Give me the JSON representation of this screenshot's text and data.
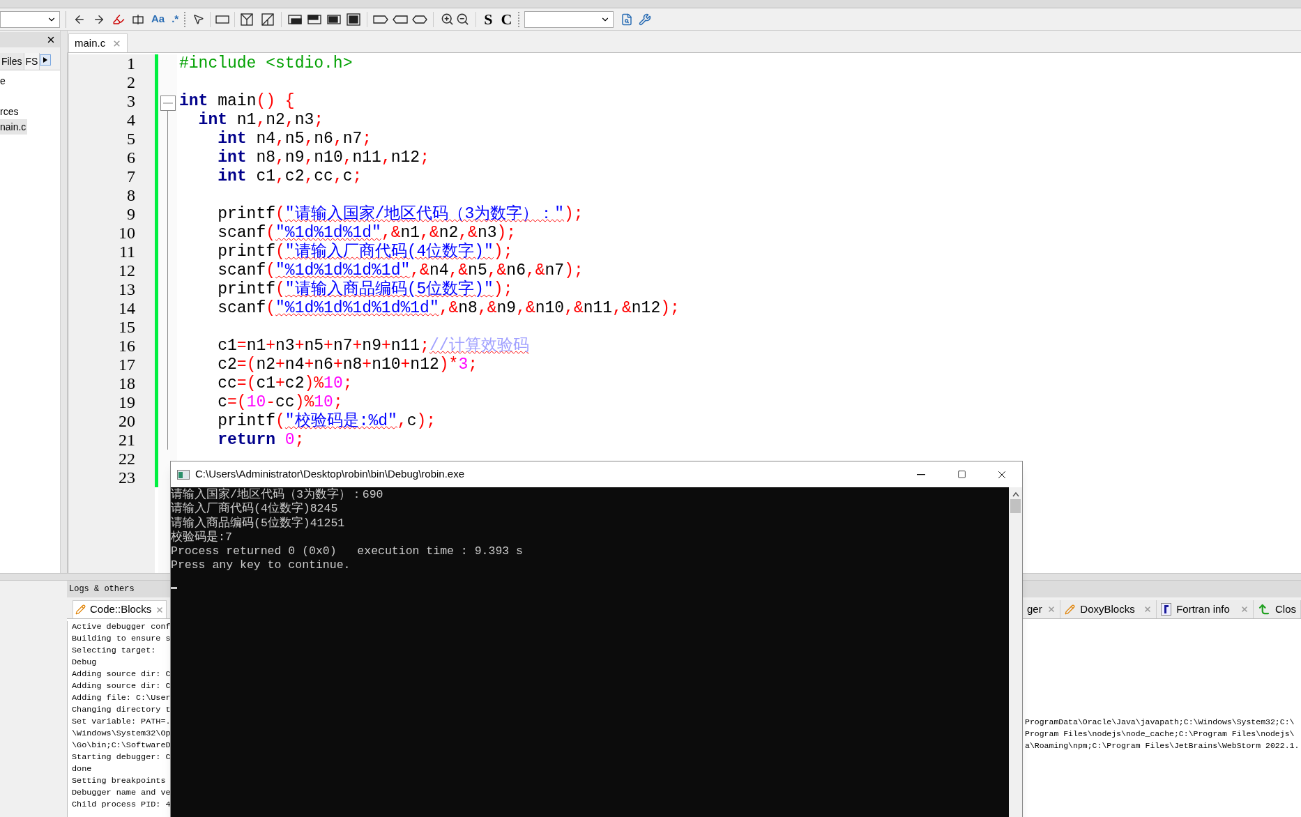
{
  "toolbar": {
    "find_buttons": [
      "Aa",
      ".*"
    ],
    "style_buttons": [
      "S",
      "C"
    ]
  },
  "left_panel": {
    "tabs": [
      {
        "label": "Files",
        "selected": true
      },
      {
        "label": "FS",
        "selected": false
      }
    ],
    "tree": [
      {
        "label": "e",
        "selected": false
      },
      {
        "label": "rces",
        "selected": false
      },
      {
        "label": "nain.c",
        "selected": true
      }
    ]
  },
  "editor": {
    "tabs": [
      {
        "label": "main.c",
        "selected": true
      }
    ],
    "lines": [
      {
        "number": "1",
        "tokens": [
          {
            "kind": "pre",
            "text": "#include <stdio.h>"
          }
        ]
      },
      {
        "number": "2"
      },
      {
        "number": "3",
        "fold": true,
        "tokens": [
          {
            "kind": "kw",
            "text": "int"
          },
          {
            "kind": "id",
            "text": " main"
          },
          {
            "kind": "op",
            "text": "() {"
          }
        ]
      },
      {
        "number": "4",
        "tokens": [
          {
            "kind": "kw",
            "text": "  int"
          },
          {
            "kind": "id",
            "text": " n1"
          },
          {
            "kind": "op",
            "text": ","
          },
          {
            "kind": "id",
            "text": "n2"
          },
          {
            "kind": "op",
            "text": ","
          },
          {
            "kind": "id",
            "text": "n3"
          },
          {
            "kind": "op",
            "text": ";"
          }
        ]
      },
      {
        "number": "5",
        "tokens": [
          {
            "kind": "kw",
            "text": "    int"
          },
          {
            "kind": "id",
            "text": " n4"
          },
          {
            "kind": "op",
            "text": ","
          },
          {
            "kind": "id",
            "text": "n5"
          },
          {
            "kind": "op",
            "text": ","
          },
          {
            "kind": "id",
            "text": "n6"
          },
          {
            "kind": "op",
            "text": ","
          },
          {
            "kind": "id",
            "text": "n7"
          },
          {
            "kind": "op",
            "text": ";"
          }
        ]
      },
      {
        "number": "6",
        "tokens": [
          {
            "kind": "kw",
            "text": "    int"
          },
          {
            "kind": "id",
            "text": " n8"
          },
          {
            "kind": "op",
            "text": ","
          },
          {
            "kind": "id",
            "text": "n9"
          },
          {
            "kind": "op",
            "text": ","
          },
          {
            "kind": "id",
            "text": "n10"
          },
          {
            "kind": "op",
            "text": ","
          },
          {
            "kind": "id",
            "text": "n11"
          },
          {
            "kind": "op",
            "text": ","
          },
          {
            "kind": "id",
            "text": "n12"
          },
          {
            "kind": "op",
            "text": ";"
          }
        ]
      },
      {
        "number": "7",
        "tokens": [
          {
            "kind": "kw",
            "text": "    int"
          },
          {
            "kind": "id",
            "text": " c1"
          },
          {
            "kind": "op",
            "text": ","
          },
          {
            "kind": "id",
            "text": "c2"
          },
          {
            "kind": "op",
            "text": ","
          },
          {
            "kind": "id",
            "text": "cc"
          },
          {
            "kind": "op",
            "text": ","
          },
          {
            "kind": "id",
            "text": "c"
          },
          {
            "kind": "op",
            "text": ";"
          }
        ]
      },
      {
        "number": "8"
      },
      {
        "number": "9",
        "tokens": [
          {
            "kind": "id",
            "text": "    printf"
          },
          {
            "kind": "op",
            "text": "("
          },
          {
            "kind": "str",
            "text": "\"请输入国家/地区代码（3为数字）：\""
          },
          {
            "kind": "op",
            "text": ");"
          }
        ]
      },
      {
        "number": "10",
        "tokens": [
          {
            "kind": "id",
            "text": "    scanf"
          },
          {
            "kind": "op",
            "text": "("
          },
          {
            "kind": "str",
            "text": "\"%1d%1d%1d\""
          },
          {
            "kind": "op",
            "text": ",&"
          },
          {
            "kind": "id",
            "text": "n1"
          },
          {
            "kind": "op",
            "text": ",&"
          },
          {
            "kind": "id",
            "text": "n2"
          },
          {
            "kind": "op",
            "text": ",&"
          },
          {
            "kind": "id",
            "text": "n3"
          },
          {
            "kind": "op",
            "text": ");"
          }
        ]
      },
      {
        "number": "11",
        "tokens": [
          {
            "kind": "id",
            "text": "    printf"
          },
          {
            "kind": "op",
            "text": "("
          },
          {
            "kind": "str",
            "text": "\"请输入厂商代码(4位数字)\""
          },
          {
            "kind": "op",
            "text": ");"
          }
        ]
      },
      {
        "number": "12",
        "tokens": [
          {
            "kind": "id",
            "text": "    scanf"
          },
          {
            "kind": "op",
            "text": "("
          },
          {
            "kind": "str",
            "text": "\"%1d%1d%1d%1d\""
          },
          {
            "kind": "op",
            "text": ",&"
          },
          {
            "kind": "id",
            "text": "n4"
          },
          {
            "kind": "op",
            "text": ",&"
          },
          {
            "kind": "id",
            "text": "n5"
          },
          {
            "kind": "op",
            "text": ",&"
          },
          {
            "kind": "id",
            "text": "n6"
          },
          {
            "kind": "op",
            "text": ",&"
          },
          {
            "kind": "id",
            "text": "n7"
          },
          {
            "kind": "op",
            "text": ");"
          }
        ]
      },
      {
        "number": "13",
        "tokens": [
          {
            "kind": "id",
            "text": "    printf"
          },
          {
            "kind": "op",
            "text": "("
          },
          {
            "kind": "str",
            "text": "\"请输入商品编码(5位数字)\""
          },
          {
            "kind": "op",
            "text": ");"
          }
        ]
      },
      {
        "number": "14",
        "tokens": [
          {
            "kind": "id",
            "text": "    scanf"
          },
          {
            "kind": "op",
            "text": "("
          },
          {
            "kind": "str",
            "text": "\"%1d%1d%1d%1d%1d\""
          },
          {
            "kind": "op",
            "text": ",&"
          },
          {
            "kind": "id",
            "text": "n8"
          },
          {
            "kind": "op",
            "text": ",&"
          },
          {
            "kind": "id",
            "text": "n9"
          },
          {
            "kind": "op",
            "text": ",&"
          },
          {
            "kind": "id",
            "text": "n10"
          },
          {
            "kind": "op",
            "text": ",&"
          },
          {
            "kind": "id",
            "text": "n11"
          },
          {
            "kind": "op",
            "text": ",&"
          },
          {
            "kind": "id",
            "text": "n12"
          },
          {
            "kind": "op",
            "text": ");"
          }
        ]
      },
      {
        "number": "15"
      },
      {
        "number": "16",
        "tokens": [
          {
            "kind": "id",
            "text": "    c1"
          },
          {
            "kind": "op",
            "text": "="
          },
          {
            "kind": "id",
            "text": "n1"
          },
          {
            "kind": "op",
            "text": "+"
          },
          {
            "kind": "id",
            "text": "n3"
          },
          {
            "kind": "op",
            "text": "+"
          },
          {
            "kind": "id",
            "text": "n5"
          },
          {
            "kind": "op",
            "text": "+"
          },
          {
            "kind": "id",
            "text": "n7"
          },
          {
            "kind": "op",
            "text": "+"
          },
          {
            "kind": "id",
            "text": "n9"
          },
          {
            "kind": "op",
            "text": "+"
          },
          {
            "kind": "id",
            "text": "n11"
          },
          {
            "kind": "op",
            "text": ";"
          },
          {
            "kind": "cmt",
            "text": "//计算效验码"
          }
        ]
      },
      {
        "number": "17",
        "tokens": [
          {
            "kind": "id",
            "text": "    c2"
          },
          {
            "kind": "op",
            "text": "=("
          },
          {
            "kind": "id",
            "text": "n2"
          },
          {
            "kind": "op",
            "text": "+"
          },
          {
            "kind": "id",
            "text": "n4"
          },
          {
            "kind": "op",
            "text": "+"
          },
          {
            "kind": "id",
            "text": "n6"
          },
          {
            "kind": "op",
            "text": "+"
          },
          {
            "kind": "id",
            "text": "n8"
          },
          {
            "kind": "op",
            "text": "+"
          },
          {
            "kind": "id",
            "text": "n10"
          },
          {
            "kind": "op",
            "text": "+"
          },
          {
            "kind": "id",
            "text": "n12"
          },
          {
            "kind": "op",
            "text": ")*"
          },
          {
            "kind": "num",
            "text": "3"
          },
          {
            "kind": "op",
            "text": ";"
          }
        ]
      },
      {
        "number": "18",
        "tokens": [
          {
            "kind": "id",
            "text": "    cc"
          },
          {
            "kind": "op",
            "text": "=("
          },
          {
            "kind": "id",
            "text": "c1"
          },
          {
            "kind": "op",
            "text": "+"
          },
          {
            "kind": "id",
            "text": "c2"
          },
          {
            "kind": "op",
            "text": ")%"
          },
          {
            "kind": "num",
            "text": "10"
          },
          {
            "kind": "op",
            "text": ";"
          }
        ]
      },
      {
        "number": "19",
        "tokens": [
          {
            "kind": "id",
            "text": "    c"
          },
          {
            "kind": "op",
            "text": "=("
          },
          {
            "kind": "num",
            "text": "10"
          },
          {
            "kind": "op",
            "text": "-"
          },
          {
            "kind": "id",
            "text": "cc"
          },
          {
            "kind": "op",
            "text": ")%"
          },
          {
            "kind": "num",
            "text": "10"
          },
          {
            "kind": "op",
            "text": ";"
          }
        ]
      },
      {
        "number": "20",
        "tokens": [
          {
            "kind": "id",
            "text": "    printf"
          },
          {
            "kind": "op",
            "text": "("
          },
          {
            "kind": "str",
            "text": "\"校验码是:%d\""
          },
          {
            "kind": "op",
            "text": ","
          },
          {
            "kind": "id",
            "text": "c"
          },
          {
            "kind": "op",
            "text": ");"
          }
        ]
      },
      {
        "number": "21",
        "tokens": [
          {
            "kind": "kw",
            "text": "    return"
          },
          {
            "kind": "num",
            "text": " 0"
          },
          {
            "kind": "op",
            "text": ";"
          }
        ]
      },
      {
        "number": "22"
      },
      {
        "number": "23"
      }
    ]
  },
  "logs": {
    "title": "Logs & others",
    "left_tabs": [
      {
        "label": "Code::Blocks",
        "selected": true
      }
    ],
    "right_tabs": [
      {
        "label": "ger",
        "selected": false
      },
      {
        "label": "DoxyBlocks",
        "selected": false
      },
      {
        "label": "Fortran info",
        "selected": false
      },
      {
        "label": "Clos",
        "selected": false
      }
    ],
    "lines": [
      "Active debugger conf",
      "Building to ensure s",
      "Selecting target:",
      "Debug",
      "Adding source dir: C",
      "Adding source dir: C",
      "Adding file: C:\\User",
      "Changing directory t",
      "Set variable: PATH=.",
      "\\Windows\\System32\\Op",
      "\\Go\\bin;C:\\SoftwareD",
      "Starting debugger: C",
      "done",
      "Setting breakpoints",
      "Debugger name and ve",
      "Child process PID: 4"
    ],
    "right_lines": [
      "ProgramData\\Oracle\\Java\\javapath;C:\\Windows\\System32;C:\\",
      "Program Files\\nodejs\\node_cache;C:\\Program Files\\nodejs\\",
      "a\\Roaming\\npm;C:\\Program Files\\JetBrains\\WebStorm 2022.1."
    ]
  },
  "console": {
    "title": "C:\\Users\\Administrator\\Desktop\\robin\\bin\\Debug\\robin.exe",
    "lines": [
      "请输入国家/地区代码（3为数字）：690",
      "请输入厂商代码(4位数字)8245",
      "请输入商品编码(5位数字)41251",
      "校验码是:7",
      "Process returned 0 (0x0)   execution time : 9.393 s",
      "Press any key to continue."
    ]
  }
}
